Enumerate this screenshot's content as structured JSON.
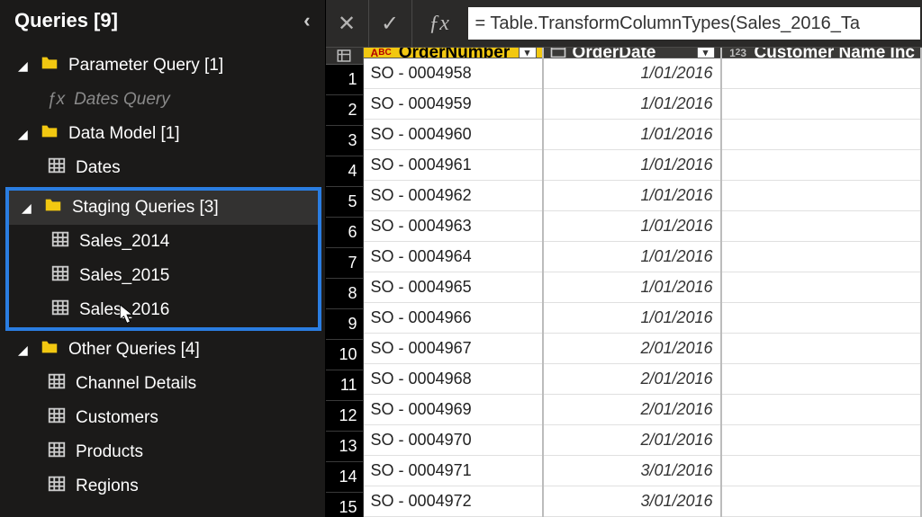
{
  "panel": {
    "title": "Queries [9]"
  },
  "tree": {
    "group_param": "Parameter Query [1]",
    "dates_query": "Dates Query",
    "group_datamodel": "Data Model [1]",
    "dates": "Dates",
    "group_staging": "Staging Queries [3]",
    "sales_2014": "Sales_2014",
    "sales_2015": "Sales_2015",
    "sales_2016": "Sales_2016",
    "group_other": "Other Queries [4]",
    "channel_details": "Channel Details",
    "customers": "Customers",
    "products": "Products",
    "regions": "Regions"
  },
  "formula": {
    "value": "= Table.TransformColumnTypes(Sales_2016_Ta"
  },
  "columns": {
    "ordernum": "OrderNumber",
    "orderdate": "OrderDate",
    "custind": "Customer Name Inc"
  },
  "rows": [
    {
      "n": "1",
      "ordernum": "SO - 0004958",
      "orderdate": "1/01/2016"
    },
    {
      "n": "2",
      "ordernum": "SO - 0004959",
      "orderdate": "1/01/2016"
    },
    {
      "n": "3",
      "ordernum": "SO - 0004960",
      "orderdate": "1/01/2016"
    },
    {
      "n": "4",
      "ordernum": "SO - 0004961",
      "orderdate": "1/01/2016"
    },
    {
      "n": "5",
      "ordernum": "SO - 0004962",
      "orderdate": "1/01/2016"
    },
    {
      "n": "6",
      "ordernum": "SO - 0004963",
      "orderdate": "1/01/2016"
    },
    {
      "n": "7",
      "ordernum": "SO - 0004964",
      "orderdate": "1/01/2016"
    },
    {
      "n": "8",
      "ordernum": "SO - 0004965",
      "orderdate": "1/01/2016"
    },
    {
      "n": "9",
      "ordernum": "SO - 0004966",
      "orderdate": "1/01/2016"
    },
    {
      "n": "10",
      "ordernum": "SO - 0004967",
      "orderdate": "2/01/2016"
    },
    {
      "n": "11",
      "ordernum": "SO - 0004968",
      "orderdate": "2/01/2016"
    },
    {
      "n": "12",
      "ordernum": "SO - 0004969",
      "orderdate": "2/01/2016"
    },
    {
      "n": "13",
      "ordernum": "SO - 0004970",
      "orderdate": "2/01/2016"
    },
    {
      "n": "14",
      "ordernum": "SO - 0004971",
      "orderdate": "3/01/2016"
    },
    {
      "n": "15",
      "ordernum": "SO - 0004972",
      "orderdate": "3/01/2016"
    }
  ]
}
